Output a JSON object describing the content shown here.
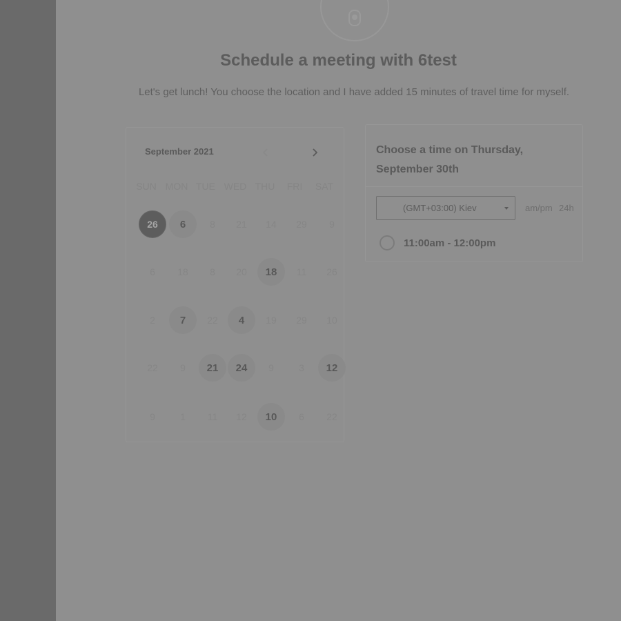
{
  "header": {
    "title": "Schedule a meeting with 6test",
    "subtitle": "Let's get lunch! You choose the location and I have added 15 minutes of travel time for myself."
  },
  "calendar": {
    "month": "September 2021",
    "weekdays": [
      "SUN",
      "MON",
      "TUE",
      "WED",
      "THU",
      "FRI",
      "SAT"
    ],
    "rows": [
      [
        {
          "n": "26",
          "s": "selected"
        },
        {
          "n": "6",
          "s": "available"
        },
        {
          "n": "8",
          "s": "disabled"
        },
        {
          "n": "21",
          "s": "disabled"
        },
        {
          "n": "14",
          "s": "disabled"
        },
        {
          "n": "29",
          "s": "disabled"
        },
        {
          "n": "9",
          "s": "disabled"
        }
      ],
      [
        {
          "n": "6",
          "s": "disabled"
        },
        {
          "n": "18",
          "s": "disabled"
        },
        {
          "n": "8",
          "s": "disabled"
        },
        {
          "n": "20",
          "s": "disabled"
        },
        {
          "n": "18",
          "s": "available"
        },
        {
          "n": "11",
          "s": "disabled"
        },
        {
          "n": "26",
          "s": "disabled"
        }
      ],
      [
        {
          "n": "2",
          "s": "disabled"
        },
        {
          "n": "7",
          "s": "available"
        },
        {
          "n": "22",
          "s": "disabled"
        },
        {
          "n": "4",
          "s": "available"
        },
        {
          "n": "19",
          "s": "disabled"
        },
        {
          "n": "29",
          "s": "disabled"
        },
        {
          "n": "10",
          "s": "disabled"
        }
      ],
      [
        {
          "n": "22",
          "s": "disabled"
        },
        {
          "n": "9",
          "s": "disabled"
        },
        {
          "n": "21",
          "s": "available"
        },
        {
          "n": "24",
          "s": "available"
        },
        {
          "n": "9",
          "s": "disabled"
        },
        {
          "n": "3",
          "s": "disabled"
        },
        {
          "n": "12",
          "s": "available"
        }
      ],
      [
        {
          "n": "9",
          "s": "disabled"
        },
        {
          "n": "1",
          "s": "disabled"
        },
        {
          "n": "11",
          "s": "disabled"
        },
        {
          "n": "12",
          "s": "disabled"
        },
        {
          "n": "10",
          "s": "available"
        },
        {
          "n": "6",
          "s": "disabled"
        },
        {
          "n": "22",
          "s": "disabled"
        }
      ]
    ]
  },
  "times": {
    "heading": "Choose a time on Thursday, September 30th",
    "timezone": "(GMT+03:00) Kiev",
    "format_ampm": "am/pm",
    "format_24h": "24h",
    "slots": [
      "11:00am - 12:00pm"
    ]
  },
  "icons": {
    "avatar": "user-avatar-icon",
    "prev": "chevron-left-icon",
    "next": "chevron-right-icon",
    "dropdown": "caret-down-icon"
  }
}
